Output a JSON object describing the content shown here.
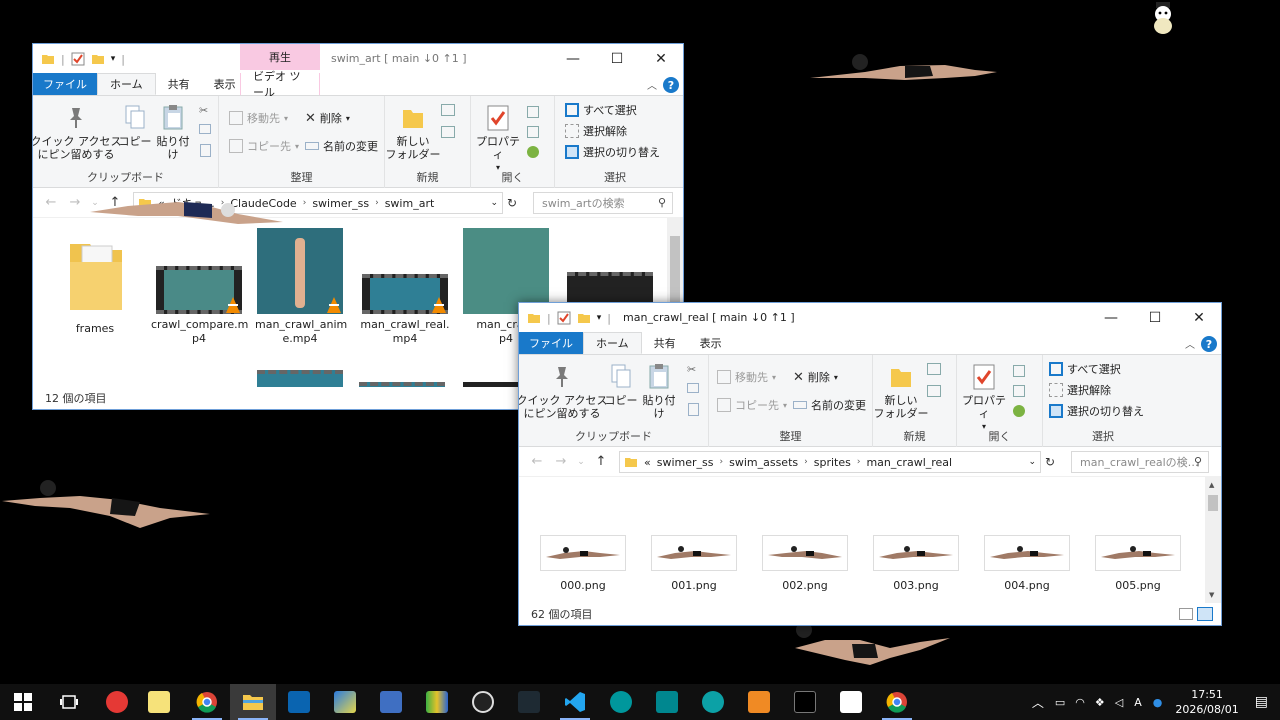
{
  "window1": {
    "title": "swim_art [ main ↓0 ↑1 ]",
    "context_tab_top": "再生",
    "context_tab_bottom": "ビデオ ツール",
    "tabs": [
      "ファイル",
      "ホーム",
      "共有",
      "表示"
    ],
    "ribbon": {
      "clipboard": {
        "label": "クリップボード",
        "pin": "クイック アクセス\nにピン留めする",
        "copy": "コピー",
        "paste": "貼り付け"
      },
      "organize": {
        "label": "整理",
        "move_to": "移動先",
        "copy_to": "コピー先",
        "delete": "削除",
        "rename": "名前の変更"
      },
      "new": {
        "label": "新規",
        "new_folder": "新しい\nフォルダー"
      },
      "open": {
        "label": "開く",
        "properties": "プロパティ"
      },
      "select": {
        "label": "選択",
        "select_all": "すべて選択",
        "select_none": "選択解除",
        "invert": "選択の切り替え"
      }
    },
    "breadcrumb": [
      "«",
      "ドキュ…",
      "ClaudeCode",
      "swimer_ss",
      "swim_art"
    ],
    "search_placeholder": "swim_artの検索",
    "items": [
      {
        "name": "frames",
        "type": "folder"
      },
      {
        "name": "crawl_compare.mp4",
        "type": "video"
      },
      {
        "name": "man_crawl_anime.mp4",
        "type": "video"
      },
      {
        "name": "man_crawl_real.mp4",
        "type": "video"
      },
      {
        "name": "man_crawl…mp4",
        "type": "video"
      }
    ],
    "item_labels": [
      "frames",
      "crawl_compare.m\np4",
      "man_crawl_anim\ne.mp4",
      "man_crawl_real.\nmp4",
      "man_crawl\np4"
    ],
    "status": "12 個の項目"
  },
  "window2": {
    "title": "man_crawl_real [ main ↓0 ↑1 ]",
    "tabs": [
      "ファイル",
      "ホーム",
      "共有",
      "表示"
    ],
    "ribbon": {
      "clipboard": {
        "label": "クリップボード",
        "pin": "クイック アクセス\nにピン留めする",
        "copy": "コピー",
        "paste": "貼り付け"
      },
      "organize": {
        "label": "整理",
        "move_to": "移動先",
        "copy_to": "コピー先",
        "delete": "削除",
        "rename": "名前の変更"
      },
      "new": {
        "label": "新規",
        "new_folder": "新しい\nフォルダー"
      },
      "open": {
        "label": "開く",
        "properties": "プロパティ"
      },
      "select": {
        "label": "選択",
        "select_all": "すべて選択",
        "select_none": "選択解除",
        "invert": "選択の切り替え"
      }
    },
    "breadcrumb": [
      "«",
      "swimer_ss",
      "swim_assets",
      "sprites",
      "man_crawl_real"
    ],
    "search_placeholder": "man_crawl_realの検…",
    "items": [
      "000.png",
      "001.png",
      "002.png",
      "003.png",
      "004.png",
      "005.png"
    ],
    "status": "62 個の項目"
  },
  "taskbar": {
    "apps": [
      "start",
      "task-view",
      "app-red",
      "app-notes",
      "chrome",
      "file-explorer",
      "outlook",
      "app-blue",
      "app-remote",
      "app-dev",
      "obs",
      "terminal",
      "vscode",
      "arduino",
      "arduino-alt",
      "arduino-ide",
      "app-orange",
      "app-inkscape",
      "app-a4",
      "chrome-2"
    ],
    "ime": "A",
    "time": "17:51",
    "date": "2026/08/01"
  },
  "colors": {
    "accent": "#1979ca",
    "context_tab": "#f9c9e2",
    "taskbar": "#101010"
  }
}
